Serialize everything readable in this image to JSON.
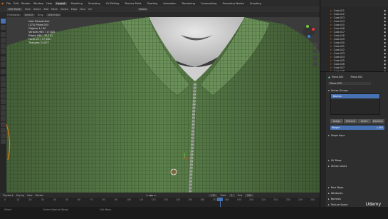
{
  "topbar": {
    "menus": [
      "File",
      "Edit",
      "Render",
      "Window",
      "Help"
    ],
    "workspaces": [
      "Layout",
      "Modeling",
      "Sculpting",
      "UV Editing",
      "Texture Paint",
      "Shading",
      "Animation",
      "Rendering",
      "Compositing",
      "Geometry Nodes",
      "Scripting"
    ],
    "active_workspace": "Layout",
    "scene_label": "Scene",
    "viewlayer_label": "ViewLayer"
  },
  "viewport_header": {
    "mode": "Edit Mode",
    "menus": [
      "View",
      "Select",
      "Add",
      "Mesh",
      "Vertex",
      "Edge",
      "Face",
      "UV"
    ],
    "transform": "Global"
  },
  "tool_header": {
    "orientation": "Orientation",
    "default": "Default",
    "drag": "Drag",
    "select": "Select Box"
  },
  "overlay": {
    "lines": [
      "User Perspective",
      "(172) Plane.003",
      "Objects   1 / 90",
      "Vertices  963 / 17,820",
      "Edges     948 / 35,142",
      "Faces     21 / 17,361",
      "Triangles 33,677"
    ]
  },
  "outliner": {
    "items": [
      "Cube.011",
      "Cube.012",
      "Cube.013",
      "Cube.014",
      "Cube.015",
      "Cube.016",
      "Cube.017",
      "Cube.018",
      "Cube.019",
      "Cube.020",
      "Cube.021",
      "Cube.022",
      "Cube.023",
      "Cube.024",
      "Cube.025",
      "Cube.026",
      "Cube.027",
      "Cube.028"
    ]
  },
  "properties": {
    "object_name": "Plane.003",
    "mesh_name": "Plane.003",
    "vertex_groups_label": "Vertex Groups",
    "vertex_group_item": "Beams",
    "buttons": [
      "Assign",
      "Remove",
      "Select",
      "Deselect"
    ],
    "weight_label": "Weight",
    "weight_value": "1.000",
    "sections": [
      "Shape Keys",
      "UV Maps",
      "Vertex Colors",
      "Face Maps",
      "Attributes",
      "Normals",
      "Texture Space"
    ]
  },
  "timeline": {
    "menus": [
      "Playback",
      "Keying",
      "View",
      "Marker"
    ],
    "current_frame": "172",
    "start_label": "Start",
    "start": "1",
    "end_label": "End",
    "end": "250",
    "ticks": [
      "0",
      "10",
      "20",
      "30",
      "40",
      "50",
      "60",
      "70",
      "80",
      "90",
      "100",
      "110",
      "120",
      "130",
      "140",
      "150",
      "160",
      "170",
      "180",
      "190",
      "200",
      "210",
      "220",
      "230",
      "240",
      "250"
    ]
  },
  "status": {
    "left": "Select",
    "mid": "Center View to Mouse",
    "right": "Call Menu"
  },
  "watermark": "Udemy",
  "colors": {
    "shirt": "#5b7f4a",
    "skin": "#d6d6d6",
    "accent": "#4772b3",
    "outline_orange": "#e8761a"
  }
}
